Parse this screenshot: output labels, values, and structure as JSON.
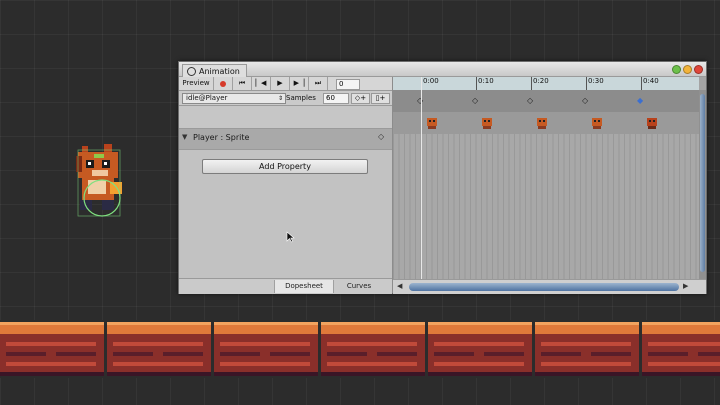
{
  "window": {
    "title": "Animation",
    "title_icon": "clock-icon"
  },
  "toolbar": {
    "preview_label": "Preview",
    "record_icon": "record-icon",
    "first_icon": "skip-first-icon",
    "prev_icon": "prev-key-icon",
    "play_icon": "play-icon",
    "next_icon": "next-key-icon",
    "last_icon": "skip-last-icon",
    "frame_value": "0"
  },
  "clip": {
    "selected": "idle@Player",
    "samples_label": "Samples",
    "samples_value": "60",
    "add_key_icon": "add-keyframe-icon",
    "add_event_icon": "add-event-icon"
  },
  "properties": [
    {
      "label": "Player : Sprite"
    }
  ],
  "add_property_label": "Add Property",
  "bottom_tabs": [
    {
      "label": "Dopesheet",
      "active": true
    },
    {
      "label": "Curves",
      "active": false
    }
  ],
  "timeline": {
    "ticks": [
      "0:00",
      "0:10",
      "0:20",
      "0:30",
      "0:40"
    ],
    "keyframes": [
      "0:00",
      "0:10",
      "0:20",
      "0:30",
      "0:40"
    ]
  },
  "colors": {
    "ruler": "#c9d7da",
    "scrollbar": "#5f7ea5",
    "record": "#d63a2a"
  }
}
